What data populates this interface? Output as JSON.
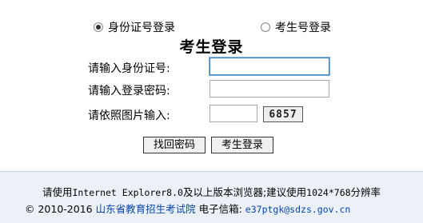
{
  "radio_options": [
    {
      "label": "身份证号登录",
      "selected": true
    },
    {
      "label": "考生号登录",
      "selected": false
    }
  ],
  "title": "考生登录",
  "form": {
    "id_label": "请输入身份证号:",
    "id_value": "",
    "password_label": "请输入登录密码:",
    "password_value": "",
    "captcha_label": "请依照图片输入:",
    "captcha_value": "",
    "captcha_image_text": "6857"
  },
  "buttons": {
    "find_password": "找回密码",
    "login": "考生登录"
  },
  "footer": {
    "browser_note_prefix": "请使用",
    "browser_name": "Internet Explorer8.0",
    "browser_note_mid": "及以上版本浏览器;建议使用",
    "resolution": "1024*768",
    "browser_note_suffix": "分辨率",
    "copyright": "© 2010-2016",
    "org_name": "山东省教育招生考试院",
    "email_label": "电子信箱:",
    "email": "e37ptgk@sdzs.gov.cn"
  },
  "colors": {
    "link": "#0645ad",
    "footer_bg": "#ebf1f7",
    "focus_border": "#3c7fb1"
  }
}
